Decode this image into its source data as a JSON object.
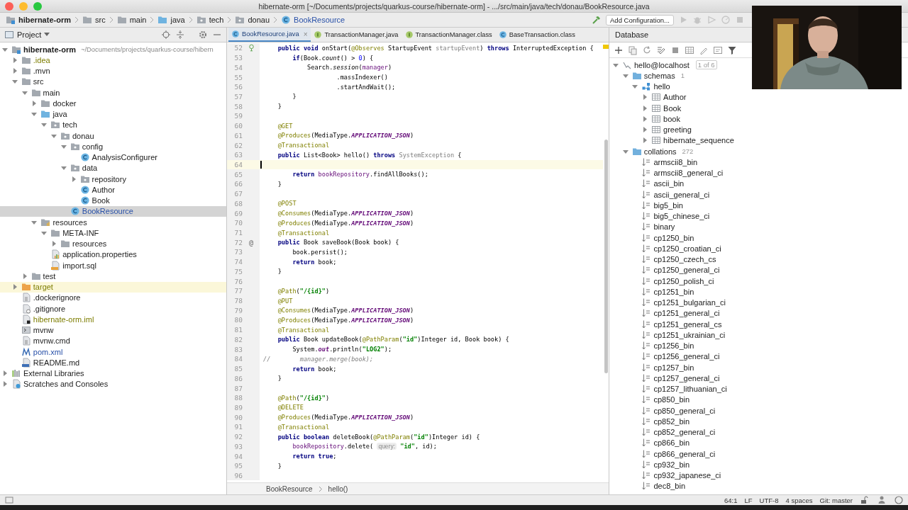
{
  "window": {
    "title": "hibernate-orm [~/Documents/projects/quarkus-course/hibernate-orm] - .../src/main/java/tech/donau/BookResource.java"
  },
  "breadcrumbs": [
    {
      "label": "hibernate-orm",
      "kind": "project"
    },
    {
      "label": "src",
      "kind": "folder"
    },
    {
      "label": "main",
      "kind": "folder"
    },
    {
      "label": "java",
      "kind": "source"
    },
    {
      "label": "tech",
      "kind": "package"
    },
    {
      "label": "donau",
      "kind": "package"
    },
    {
      "label": "BookResource",
      "kind": "class"
    }
  ],
  "toolbar": {
    "run_configuration": "Add Configuration..."
  },
  "project_panel": {
    "title": "Project",
    "tree": [
      {
        "label": "hibernate-orm",
        "path": "~/Documents/projects/quarkus-course/hibern",
        "kind": "module",
        "expanded": true,
        "selected": false,
        "ignored": false,
        "modified": false,
        "children": [
          {
            "label": ".idea",
            "kind": "folder",
            "expanded": false,
            "selected": false,
            "ignored": true,
            "modified": false
          },
          {
            "label": ".mvn",
            "kind": "folder",
            "expanded": false,
            "selected": false,
            "ignored": false,
            "modified": false
          },
          {
            "label": "src",
            "kind": "folder",
            "expanded": true,
            "selected": false,
            "ignored": false,
            "modified": false,
            "children": [
              {
                "label": "main",
                "kind": "folder",
                "expanded": true,
                "selected": false,
                "ignored": false,
                "modified": false,
                "children": [
                  {
                    "label": "docker",
                    "kind": "folder",
                    "expanded": false,
                    "selected": false,
                    "ignored": false,
                    "modified": false
                  },
                  {
                    "label": "java",
                    "kind": "source",
                    "expanded": true,
                    "selected": false,
                    "ignored": false,
                    "modified": false,
                    "children": [
                      {
                        "label": "tech",
                        "kind": "package",
                        "expanded": true,
                        "selected": false,
                        "ignored": false,
                        "modified": false,
                        "children": [
                          {
                            "label": "donau",
                            "kind": "package",
                            "expanded": true,
                            "selected": false,
                            "ignored": false,
                            "modified": false,
                            "children": [
                              {
                                "label": "config",
                                "kind": "package",
                                "expanded": true,
                                "selected": false,
                                "ignored": false,
                                "modified": false,
                                "children": [
                                  {
                                    "label": "AnalysisConfigurer",
                                    "kind": "class",
                                    "selected": false,
                                    "ignored": false,
                                    "modified": false
                                  }
                                ]
                              },
                              {
                                "label": "data",
                                "kind": "package",
                                "expanded": true,
                                "selected": false,
                                "ignored": false,
                                "modified": false,
                                "children": [
                                  {
                                    "label": "repository",
                                    "kind": "package",
                                    "expanded": false,
                                    "selected": false,
                                    "ignored": false,
                                    "modified": false
                                  },
                                  {
                                    "label": "Author",
                                    "kind": "class",
                                    "selected": false,
                                    "ignored": false,
                                    "modified": false
                                  },
                                  {
                                    "label": "Book",
                                    "kind": "class",
                                    "selected": false,
                                    "ignored": false,
                                    "modified": false
                                  }
                                ]
                              },
                              {
                                "label": "BookResource",
                                "kind": "class",
                                "selected": true,
                                "ignored": false,
                                "modified": true
                              }
                            ]
                          }
                        ]
                      }
                    ]
                  },
                  {
                    "label": "resources",
                    "kind": "resources",
                    "expanded": true,
                    "selected": false,
                    "ignored": false,
                    "modified": false,
                    "children": [
                      {
                        "label": "META-INF",
                        "kind": "folder",
                        "expanded": true,
                        "selected": false,
                        "ignored": false,
                        "modified": false,
                        "children": [
                          {
                            "label": "resources",
                            "kind": "folder",
                            "expanded": false,
                            "selected": false,
                            "ignored": false,
                            "modified": false
                          }
                        ]
                      },
                      {
                        "label": "application.properties",
                        "kind": "properties",
                        "selected": false,
                        "ignored": false,
                        "modified": false
                      },
                      {
                        "label": "import.sql",
                        "kind": "sql",
                        "selected": false,
                        "ignored": false,
                        "modified": false
                      }
                    ]
                  }
                ]
              },
              {
                "label": "test",
                "kind": "folder",
                "expanded": false,
                "selected": false,
                "ignored": false,
                "modified": false
              }
            ]
          },
          {
            "label": "target",
            "kind": "excluded",
            "expanded": false,
            "selected": false,
            "ignored": true,
            "modified": false
          },
          {
            "label": ".dockerignore",
            "kind": "file",
            "selected": false,
            "ignored": false,
            "modified": false
          },
          {
            "label": ".gitignore",
            "kind": "ignore",
            "selected": false,
            "ignored": false,
            "modified": false
          },
          {
            "label": "hibernate-orm.iml",
            "kind": "iml",
            "selected": false,
            "ignored": true,
            "modified": false
          },
          {
            "label": "mvnw",
            "kind": "exec",
            "selected": false,
            "ignored": false,
            "modified": false
          },
          {
            "label": "mvnw.cmd",
            "kind": "file",
            "selected": false,
            "ignored": false,
            "modified": false
          },
          {
            "label": "pom.xml",
            "kind": "maven",
            "selected": false,
            "ignored": false,
            "modified": true
          },
          {
            "label": "README.md",
            "kind": "md",
            "selected": false,
            "ignored": false,
            "modified": false
          }
        ]
      },
      {
        "label": "External Libraries",
        "kind": "libs",
        "expanded": false,
        "selected": false,
        "ignored": false,
        "modified": false
      },
      {
        "label": "Scratches and Consoles",
        "kind": "scratch",
        "expanded": false,
        "selected": false,
        "ignored": false,
        "modified": false
      }
    ]
  },
  "editor": {
    "tabs": [
      {
        "label": "BookResource.java",
        "kind": "class",
        "selected": true,
        "close": "×"
      },
      {
        "label": "TransactionManager.java",
        "kind": "interface",
        "selected": false
      },
      {
        "label": "TransactionManager.class",
        "kind": "interface",
        "selected": false
      },
      {
        "label": "BaseTransaction.class",
        "kind": "class",
        "selected": false
      }
    ],
    "lines": [
      {
        "number": "52",
        "current": false,
        "gutter": {
          "kind": "bean"
        },
        "tokens": [
          {
            "kind": "kw",
            "text": "    public"
          },
          {
            "kind": "kw",
            "text": " void"
          },
          {
            "kind": "plain",
            "text": " onStart("
          },
          {
            "kind": "ann",
            "text": "@Observes"
          },
          {
            "kind": "plain",
            "text": " StartupEvent "
          },
          {
            "kind": "unused",
            "text": "startupEvent"
          },
          {
            "kind": "plain",
            "text": ") "
          },
          {
            "kind": "kw",
            "text": "throws"
          },
          {
            "kind": "plain",
            "text": " InterruptedException {"
          }
        ]
      },
      {
        "number": "53",
        "current": false,
        "tokens": [
          {
            "kind": "kw",
            "text": "        if"
          },
          {
            "kind": "plain",
            "text": "(Book."
          },
          {
            "kind": "static",
            "text": "count"
          },
          {
            "kind": "plain",
            "text": "() > "
          },
          {
            "kind": "num",
            "text": "0"
          },
          {
            "kind": "plain",
            "text": ") {"
          }
        ]
      },
      {
        "number": "54",
        "current": false,
        "tokens": [
          {
            "kind": "plain",
            "text": "            Search."
          },
          {
            "kind": "static",
            "text": "session"
          },
          {
            "kind": "plain",
            "text": "("
          },
          {
            "kind": "field",
            "text": "manager"
          },
          {
            "kind": "plain",
            "text": ")"
          }
        ]
      },
      {
        "number": "55",
        "current": false,
        "tokens": [
          {
            "kind": "plain",
            "text": "                    .massIndexer()"
          }
        ]
      },
      {
        "number": "56",
        "current": false,
        "tokens": [
          {
            "kind": "plain",
            "text": "                    .startAndWait();"
          }
        ]
      },
      {
        "number": "57",
        "current": false,
        "tokens": [
          {
            "kind": "plain",
            "text": "        }"
          }
        ]
      },
      {
        "number": "58",
        "current": false,
        "tokens": [
          {
            "kind": "plain",
            "text": "    }"
          }
        ]
      },
      {
        "number": "59",
        "current": false
      },
      {
        "number": "60",
        "current": false,
        "tokens": [
          {
            "kind": "ann",
            "text": "    @GET"
          }
        ]
      },
      {
        "number": "61",
        "current": false,
        "tokens": [
          {
            "kind": "ann",
            "text": "    @Produces"
          },
          {
            "kind": "plain",
            "text": "(MediaType."
          },
          {
            "kind": "const",
            "text": "APPLICATION_JSON"
          },
          {
            "kind": "plain",
            "text": ")"
          }
        ]
      },
      {
        "number": "62",
        "current": false,
        "tokens": [
          {
            "kind": "ann",
            "text": "    @Transactional"
          }
        ]
      },
      {
        "number": "63",
        "current": false,
        "tokens": [
          {
            "kind": "kw",
            "text": "    public"
          },
          {
            "kind": "plain",
            "text": " List<Book> hello() "
          },
          {
            "kind": "kw",
            "text": "throws"
          },
          {
            "kind": "unused",
            "text": " SystemException"
          },
          {
            "kind": "plain",
            "text": " {"
          }
        ]
      },
      {
        "number": "64",
        "current": true
      },
      {
        "number": "65",
        "current": false,
        "tokens": [
          {
            "kind": "kw",
            "text": "        return"
          },
          {
            "kind": "field",
            "text": " bookRepository"
          },
          {
            "kind": "plain",
            "text": ".findAllBooks();"
          }
        ]
      },
      {
        "number": "66",
        "current": false,
        "tokens": [
          {
            "kind": "plain",
            "text": "    }"
          }
        ]
      },
      {
        "number": "67",
        "current": false
      },
      {
        "number": "68",
        "current": false,
        "tokens": [
          {
            "kind": "ann",
            "text": "    @POST"
          }
        ]
      },
      {
        "number": "69",
        "current": false,
        "tokens": [
          {
            "kind": "ann",
            "text": "    @Consumes"
          },
          {
            "kind": "plain",
            "text": "(MediaType."
          },
          {
            "kind": "const",
            "text": "APPLICATION_JSON"
          },
          {
            "kind": "plain",
            "text": ")"
          }
        ]
      },
      {
        "number": "70",
        "current": false,
        "tokens": [
          {
            "kind": "ann",
            "text": "    @Produces"
          },
          {
            "kind": "plain",
            "text": "(MediaType."
          },
          {
            "kind": "const",
            "text": "APPLICATION_JSON"
          },
          {
            "kind": "plain",
            "text": ")"
          }
        ]
      },
      {
        "number": "71",
        "current": false,
        "tokens": [
          {
            "kind": "ann",
            "text": "    @Transactional"
          }
        ]
      },
      {
        "number": "72",
        "current": false,
        "gutter": {
          "text": "@"
        },
        "tokens": [
          {
            "kind": "kw",
            "text": "    public"
          },
          {
            "kind": "plain",
            "text": " Book saveBook(Book book) {"
          }
        ]
      },
      {
        "number": "73",
        "current": false,
        "tokens": [
          {
            "kind": "plain",
            "text": "        book.persist();"
          }
        ]
      },
      {
        "number": "74",
        "current": false,
        "tokens": [
          {
            "kind": "kw",
            "text": "        return"
          },
          {
            "kind": "plain",
            "text": " book;"
          }
        ]
      },
      {
        "number": "75",
        "current": false,
        "tokens": [
          {
            "kind": "plain",
            "text": "    }"
          }
        ]
      },
      {
        "number": "76",
        "current": false
      },
      {
        "number": "77",
        "current": false,
        "tokens": [
          {
            "kind": "ann",
            "text": "    @Path"
          },
          {
            "kind": "plain",
            "text": "("
          },
          {
            "kind": "str",
            "text": "\"/{id}\""
          },
          {
            "kind": "plain",
            "text": ")"
          }
        ]
      },
      {
        "number": "78",
        "current": false,
        "tokens": [
          {
            "kind": "ann",
            "text": "    @PUT"
          }
        ]
      },
      {
        "number": "79",
        "current": false,
        "tokens": [
          {
            "kind": "ann",
            "text": "    @Consumes"
          },
          {
            "kind": "plain",
            "text": "(MediaType."
          },
          {
            "kind": "const",
            "text": "APPLICATION_JSON"
          },
          {
            "kind": "plain",
            "text": ")"
          }
        ]
      },
      {
        "number": "80",
        "current": false,
        "tokens": [
          {
            "kind": "ann",
            "text": "    @Produces"
          },
          {
            "kind": "plain",
            "text": "(MediaType."
          },
          {
            "kind": "const",
            "text": "APPLICATION_JSON"
          },
          {
            "kind": "plain",
            "text": ")"
          }
        ]
      },
      {
        "number": "81",
        "current": false,
        "tokens": [
          {
            "kind": "ann",
            "text": "    @Transactional"
          }
        ]
      },
      {
        "number": "82",
        "current": false,
        "tokens": [
          {
            "kind": "kw",
            "text": "    public"
          },
          {
            "kind": "plain",
            "text": " Book updateBook("
          },
          {
            "kind": "ann",
            "text": "@PathParam"
          },
          {
            "kind": "plain",
            "text": "("
          },
          {
            "kind": "str",
            "text": "\"id\""
          },
          {
            "kind": "plain",
            "text": ")Integer id, Book book) {"
          }
        ]
      },
      {
        "number": "83",
        "current": false,
        "tokens": [
          {
            "kind": "plain",
            "text": "        System."
          },
          {
            "kind": "static_field",
            "text": "out"
          },
          {
            "kind": "plain",
            "text": ".println("
          },
          {
            "kind": "str",
            "text": "\"LOG2\""
          },
          {
            "kind": "plain",
            "text": ");"
          }
        ]
      },
      {
        "number": "84",
        "current": false,
        "tokens": [
          {
            "kind": "comment",
            "text": "//        manager.merge(book);"
          }
        ]
      },
      {
        "number": "85",
        "current": false,
        "tokens": [
          {
            "kind": "kw",
            "text": "        return"
          },
          {
            "kind": "plain",
            "text": " book;"
          }
        ]
      },
      {
        "number": "86",
        "current": false,
        "tokens": [
          {
            "kind": "plain",
            "text": "    }"
          }
        ]
      },
      {
        "number": "87",
        "current": false
      },
      {
        "number": "88",
        "current": false,
        "tokens": [
          {
            "kind": "ann",
            "text": "    @Path"
          },
          {
            "kind": "plain",
            "text": "("
          },
          {
            "kind": "str",
            "text": "\"/{id}\""
          },
          {
            "kind": "plain",
            "text": ")"
          }
        ]
      },
      {
        "number": "89",
        "current": false,
        "tokens": [
          {
            "kind": "ann",
            "text": "    @DELETE"
          }
        ]
      },
      {
        "number": "90",
        "current": false,
        "tokens": [
          {
            "kind": "ann",
            "text": "    @Produces"
          },
          {
            "kind": "plain",
            "text": "(MediaType."
          },
          {
            "kind": "const",
            "text": "APPLICATION_JSON"
          },
          {
            "kind": "plain",
            "text": ")"
          }
        ]
      },
      {
        "number": "91",
        "current": false,
        "tokens": [
          {
            "kind": "ann",
            "text": "    @Transactional"
          }
        ]
      },
      {
        "number": "92",
        "current": false,
        "tokens": [
          {
            "kind": "kw",
            "text": "    public"
          },
          {
            "kind": "kw",
            "text": " boolean"
          },
          {
            "kind": "plain",
            "text": " deleteBook("
          },
          {
            "kind": "ann",
            "text": "@PathParam"
          },
          {
            "kind": "plain",
            "text": "("
          },
          {
            "kind": "str",
            "text": "\"id\""
          },
          {
            "kind": "plain",
            "text": ")Integer id) {"
          }
        ]
      },
      {
        "number": "93",
        "current": false,
        "tokens": [
          {
            "kind": "field",
            "text": "        bookRepository"
          },
          {
            "kind": "plain",
            "text": ".delete( "
          },
          {
            "kind": "hint",
            "text": "query:"
          },
          {
            "kind": "str",
            "text": " \"id\""
          },
          {
            "kind": "plain",
            "text": ", id);"
          }
        ]
      },
      {
        "number": "94",
        "current": false,
        "tokens": [
          {
            "kind": "kw",
            "text": "        return"
          },
          {
            "kind": "kw",
            "text": " true"
          },
          {
            "kind": "plain",
            "text": ";"
          }
        ]
      },
      {
        "number": "95",
        "current": false,
        "tokens": [
          {
            "kind": "plain",
            "text": "    }"
          }
        ]
      },
      {
        "number": "96",
        "current": false
      }
    ],
    "breadcrumbs": [
      "BookResource",
      "hello()"
    ]
  },
  "database": {
    "title": "Database",
    "tree": [
      {
        "label": "hello@localhost",
        "badge": "1 of 6",
        "kind": "connection",
        "expanded": true,
        "selected": false,
        "children": [
          {
            "label": "schemas",
            "count": "1",
            "kind": "dbfolder",
            "expanded": true,
            "selected": false,
            "children": [
              {
                "label": "hello",
                "kind": "schema",
                "expanded": true,
                "selected": false,
                "children": [
                  {
                    "label": "Author",
                    "kind": "table",
                    "expanded": false,
                    "selected": false
                  },
                  {
                    "label": "Book",
                    "kind": "table",
                    "expanded": false,
                    "selected": false
                  },
                  {
                    "label": "book",
                    "kind": "table",
                    "expanded": false,
                    "selected": false
                  },
                  {
                    "label": "greeting",
                    "kind": "table",
                    "expanded": false,
                    "selected": false
                  },
                  {
                    "label": "hibernate_sequence",
                    "kind": "table",
                    "expanded": false,
                    "selected": false
                  }
                ]
              }
            ]
          },
          {
            "label": "collations",
            "count": "272",
            "kind": "dbfolder",
            "expanded": true,
            "selected": false,
            "children": [
              {
                "label": "armscii8_bin",
                "kind": "collation",
                "selected": false
              },
              {
                "label": "armscii8_general_ci",
                "kind": "collation",
                "selected": false
              },
              {
                "label": "ascii_bin",
                "kind": "collation",
                "selected": false
              },
              {
                "label": "ascii_general_ci",
                "kind": "collation",
                "selected": false
              },
              {
                "label": "big5_bin",
                "kind": "collation",
                "selected": false
              },
              {
                "label": "big5_chinese_ci",
                "kind": "collation",
                "selected": false
              },
              {
                "label": "binary",
                "kind": "collation",
                "selected": false
              },
              {
                "label": "cp1250_bin",
                "kind": "collation",
                "selected": false
              },
              {
                "label": "cp1250_croatian_ci",
                "kind": "collation",
                "selected": false
              },
              {
                "label": "cp1250_czech_cs",
                "kind": "collation",
                "selected": false
              },
              {
                "label": "cp1250_general_ci",
                "kind": "collation",
                "selected": false
              },
              {
                "label": "cp1250_polish_ci",
                "kind": "collation",
                "selected": false
              },
              {
                "label": "cp1251_bin",
                "kind": "collation",
                "selected": false
              },
              {
                "label": "cp1251_bulgarian_ci",
                "kind": "collation",
                "selected": false
              },
              {
                "label": "cp1251_general_ci",
                "kind": "collation",
                "selected": false
              },
              {
                "label": "cp1251_general_cs",
                "kind": "collation",
                "selected": false
              },
              {
                "label": "cp1251_ukrainian_ci",
                "kind": "collation",
                "selected": false
              },
              {
                "label": "cp1256_bin",
                "kind": "collation",
                "selected": false
              },
              {
                "label": "cp1256_general_ci",
                "kind": "collation",
                "selected": false
              },
              {
                "label": "cp1257_bin",
                "kind": "collation",
                "selected": false
              },
              {
                "label": "cp1257_general_ci",
                "kind": "collation",
                "selected": false
              },
              {
                "label": "cp1257_lithuanian_ci",
                "kind": "collation",
                "selected": false
              },
              {
                "label": "cp850_bin",
                "kind": "collation",
                "selected": false
              },
              {
                "label": "cp850_general_ci",
                "kind": "collation",
                "selected": false
              },
              {
                "label": "cp852_bin",
                "kind": "collation",
                "selected": false
              },
              {
                "label": "cp852_general_ci",
                "kind": "collation",
                "selected": false
              },
              {
                "label": "cp866_bin",
                "kind": "collation",
                "selected": false
              },
              {
                "label": "cp866_general_ci",
                "kind": "collation",
                "selected": false
              },
              {
                "label": "cp932_bin",
                "kind": "collation",
                "selected": false
              },
              {
                "label": "cp932_japanese_ci",
                "kind": "collation",
                "selected": false
              },
              {
                "label": "dec8_bin",
                "kind": "collation",
                "selected": false
              }
            ]
          }
        ]
      }
    ]
  },
  "status_bar": {
    "items": [
      "64:1",
      "LF",
      "UTF-8",
      "4 spaces",
      "Git: master"
    ]
  }
}
